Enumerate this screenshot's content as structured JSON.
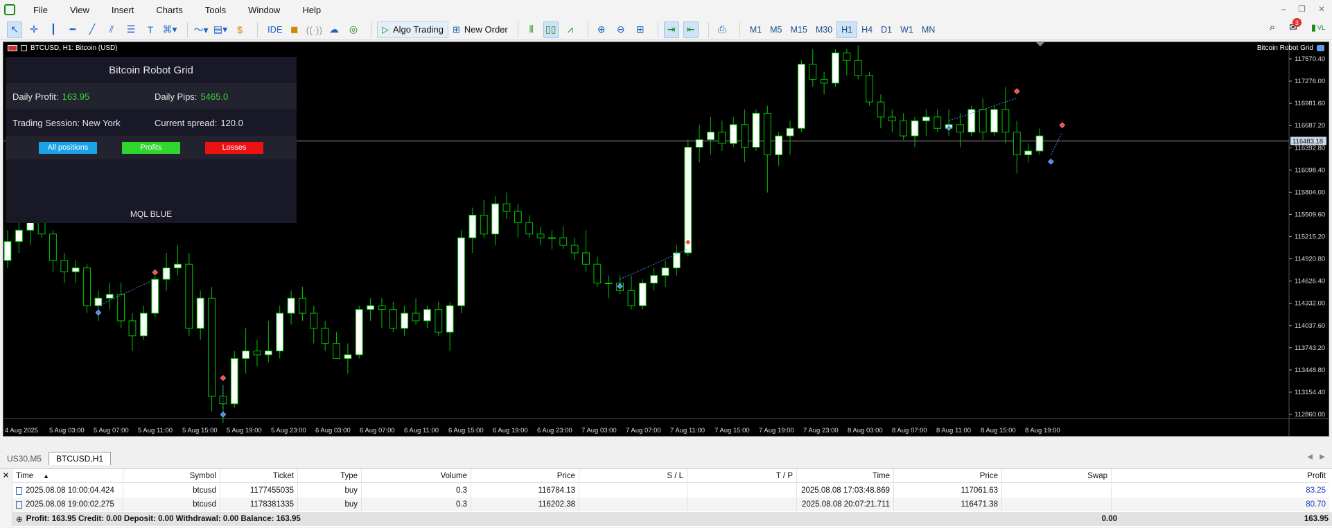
{
  "menu": [
    "File",
    "View",
    "Insert",
    "Charts",
    "Tools",
    "Window",
    "Help"
  ],
  "window_controls": [
    "⎯",
    "❐",
    "✕"
  ],
  "toolbar": {
    "ide_label": "IDE",
    "algo_trading_label": "Algo Trading",
    "new_order_label": "New Order",
    "timeframes": [
      "M1",
      "M5",
      "M15",
      "M30",
      "H1",
      "H4",
      "D1",
      "W1",
      "MN"
    ],
    "active_timeframe": "H1",
    "notification_count": "3",
    "vl_label": "VL"
  },
  "chart": {
    "title": "BTCUSD, H1:  Bitcoin (USD)",
    "ea_name": "Bitcoin Robot Grid",
    "current_price_label": "116483.18",
    "colors": {
      "background": "#000000",
      "bull_body": "#ffffff",
      "wick": "#00c800",
      "grid_line": "#9a9a9a",
      "buy_marker": "#4a8cff",
      "sell_marker": "#ff4a4a"
    }
  },
  "panel": {
    "title": "Bitcoin Robot Grid",
    "daily_profit_label": "Daily Profit:",
    "daily_profit_value": "163.95",
    "daily_pips_label": "Daily Pips:",
    "daily_pips_value": "5465.0",
    "session_label": "Trading Session: New York",
    "spread_label": "Current spread:",
    "spread_value": "120.0",
    "buttons": [
      {
        "label": "All positions",
        "color": "#1aa3e8"
      },
      {
        "label": "Profits",
        "color": "#2ed62e"
      },
      {
        "label": "Losses",
        "color": "#ee1111"
      }
    ],
    "brand": "MQL BLUE"
  },
  "chart_data": {
    "type": "candlestick",
    "symbol": "BTCUSD",
    "timeframe": "H1",
    "ylim": [
      112500,
      117800
    ],
    "y_ticks": [
      "117570.40",
      "117276.00",
      "116981.60",
      "116687.20",
      "116392.80",
      "116098.40",
      "115804.00",
      "115509.60",
      "115215.20",
      "114920.80",
      "114626.40",
      "114332.00",
      "114037.60",
      "113743.20",
      "113448.80",
      "113154.40",
      "112860.00"
    ],
    "x_labels": [
      "4 Aug 2025",
      "5 Aug 03:00",
      "5 Aug 07:00",
      "5 Aug 11:00",
      "5 Aug 15:00",
      "5 Aug 19:00",
      "5 Aug 23:00",
      "6 Aug 03:00",
      "6 Aug 07:00",
      "6 Aug 11:00",
      "6 Aug 15:00",
      "6 Aug 19:00",
      "6 Aug 23:00",
      "7 Aug 03:00",
      "7 Aug 07:00",
      "7 Aug 11:00",
      "7 Aug 15:00",
      "7 Aug 19:00",
      "7 Aug 23:00",
      "8 Aug 03:00",
      "8 Aug 07:00",
      "8 Aug 11:00",
      "8 Aug 15:00",
      "8 Aug 19:00"
    ],
    "current_price": 116483.18,
    "ohlc": [
      [
        114900,
        115300,
        114800,
        115150
      ],
      [
        115150,
        115450,
        115000,
        115300
      ],
      [
        115300,
        115600,
        115100,
        115550
      ],
      [
        115550,
        115700,
        115200,
        115250
      ],
      [
        115250,
        115300,
        114750,
        114900
      ],
      [
        114900,
        115000,
        114600,
        114750
      ],
      [
        114750,
        114900,
        114600,
        114800
      ],
      [
        114800,
        114850,
        114200,
        114300
      ],
      [
        114300,
        114500,
        114100,
        114400
      ],
      [
        114400,
        114600,
        114250,
        114450
      ],
      [
        114450,
        114600,
        114000,
        114100
      ],
      [
        114100,
        114200,
        113700,
        113900
      ],
      [
        113900,
        114300,
        113850,
        114200
      ],
      [
        114200,
        114700,
        114150,
        114650
      ],
      [
        114650,
        115000,
        114500,
        114800
      ],
      [
        114800,
        115100,
        114700,
        114850
      ],
      [
        114850,
        115000,
        113900,
        114000
      ],
      [
        114000,
        114500,
        113850,
        114400
      ],
      [
        114400,
        114550,
        112900,
        113100
      ],
      [
        113100,
        113250,
        112750,
        113000
      ],
      [
        113000,
        113700,
        112950,
        113600
      ],
      [
        113600,
        114000,
        113400,
        113700
      ],
      [
        113700,
        113850,
        113500,
        113650
      ],
      [
        113650,
        114100,
        113550,
        113700
      ],
      [
        113700,
        114300,
        113600,
        114200
      ],
      [
        114200,
        114500,
        114050,
        114400
      ],
      [
        114400,
        114550,
        114100,
        114200
      ],
      [
        114200,
        114300,
        113800,
        114000
      ],
      [
        114000,
        114100,
        113700,
        113800
      ],
      [
        113800,
        113950,
        113600,
        113600
      ],
      [
        113600,
        113800,
        113400,
        113650
      ],
      [
        113650,
        114300,
        113600,
        114250
      ],
      [
        114250,
        114400,
        114100,
        114300
      ],
      [
        114300,
        114400,
        114000,
        114250
      ],
      [
        114250,
        114350,
        113950,
        114000
      ],
      [
        114000,
        114300,
        113900,
        114200
      ],
      [
        114200,
        114400,
        114050,
        114100
      ],
      [
        114100,
        114300,
        114000,
        114250
      ],
      [
        114250,
        114350,
        113900,
        113950
      ],
      [
        113950,
        114350,
        113700,
        114300
      ],
      [
        114300,
        115300,
        114200,
        115200
      ],
      [
        115200,
        115600,
        115000,
        115500
      ],
      [
        115500,
        115700,
        115200,
        115250
      ],
      [
        115250,
        115750,
        115100,
        115650
      ],
      [
        115650,
        115800,
        115450,
        115550
      ],
      [
        115550,
        115650,
        115200,
        115400
      ],
      [
        115400,
        115500,
        115200,
        115250
      ],
      [
        115250,
        115350,
        115100,
        115200
      ],
      [
        115200,
        115300,
        115050,
        115200
      ],
      [
        115200,
        115350,
        115050,
        115100
      ],
      [
        115100,
        115200,
        114900,
        115000
      ],
      [
        115000,
        115300,
        114750,
        114850
      ],
      [
        114850,
        114950,
        114550,
        114600
      ],
      [
        114600,
        114700,
        114400,
        114600
      ],
      [
        114600,
        114700,
        114450,
        114500
      ],
      [
        114500,
        114700,
        114250,
        114300
      ],
      [
        114300,
        114650,
        114250,
        114600
      ],
      [
        114600,
        114800,
        114500,
        114700
      ],
      [
        114700,
        114900,
        114550,
        114800
      ],
      [
        114800,
        115100,
        114700,
        115000
      ],
      [
        115000,
        116500,
        114950,
        116400
      ],
      [
        116400,
        116700,
        116200,
        116500
      ],
      [
        116500,
        116800,
        116300,
        116600
      ],
      [
        116600,
        116750,
        116350,
        116450
      ],
      [
        116450,
        116800,
        116400,
        116700
      ],
      [
        116700,
        116900,
        116200,
        116400
      ],
      [
        116400,
        116900,
        116350,
        116850
      ],
      [
        116850,
        116950,
        115800,
        116300
      ],
      [
        116300,
        116600,
        116150,
        116550
      ],
      [
        116550,
        116750,
        116300,
        116650
      ],
      [
        116650,
        117550,
        116600,
        117500
      ],
      [
        117500,
        117700,
        117200,
        117300
      ],
      [
        117300,
        117400,
        117100,
        117250
      ],
      [
        117250,
        117700,
        117200,
        117650
      ],
      [
        117650,
        117700,
        117350,
        117550
      ],
      [
        117550,
        117750,
        117300,
        117350
      ],
      [
        117350,
        117400,
        116950,
        117000
      ],
      [
        117000,
        117100,
        116650,
        116800
      ],
      [
        116800,
        116900,
        116600,
        116750
      ],
      [
        116750,
        116850,
        116500,
        116550
      ],
      [
        116550,
        116800,
        116400,
        116750
      ],
      [
        116750,
        116900,
        116550,
        116800
      ],
      [
        116800,
        116900,
        116600,
        116650
      ],
      [
        116650,
        116900,
        116550,
        116700
      ],
      [
        116700,
        116850,
        116400,
        116600
      ],
      [
        116600,
        116950,
        116550,
        116900
      ],
      [
        116900,
        117050,
        116500,
        116600
      ],
      [
        116600,
        116950,
        116550,
        116900
      ],
      [
        116900,
        117200,
        116450,
        116600
      ],
      [
        116600,
        116750,
        116050,
        116300
      ],
      [
        116300,
        116450,
        116200,
        116350
      ],
      [
        116350,
        116650,
        116300,
        116550
      ]
    ],
    "trades": [
      {
        "type": "buy",
        "open_index": 8,
        "open_price": 114300,
        "close_index": 13,
        "close_price": 114650
      },
      {
        "type": "buy",
        "open_index": 19,
        "open_price": 112950,
        "close_index": 19,
        "close_price": 113250
      },
      {
        "type": "buy",
        "open_index": 54,
        "open_price": 114650,
        "close_index": 60,
        "close_price": 115050
      },
      {
        "type": "buy",
        "open_index": 83,
        "open_price": 116750,
        "close_index": 89,
        "close_price": 117050
      },
      {
        "type": "buy",
        "open_index": 92,
        "open_price": 116300,
        "close_index": 93,
        "close_price": 116600
      }
    ]
  },
  "tabs": [
    "US30,M5",
    "BTCUSD,H1"
  ],
  "active_tab": "BTCUSD,H1",
  "trade_table": {
    "headers": [
      "Time",
      "Symbol",
      "Ticket",
      "Type",
      "Volume",
      "Price",
      "S / L",
      "T / P",
      "Time",
      "Price",
      "Swap",
      "Profit"
    ],
    "sort_indicator": "▲",
    "rows": [
      [
        "2025.08.08 10:00:04.424",
        "btcusd",
        "1177455035",
        "buy",
        "0.3",
        "116784.13",
        "",
        "",
        "2025.08.08 17:03:48.869",
        "117061.63",
        "",
        "83.25"
      ],
      [
        "2025.08.08 19:00:02.275",
        "btcusd",
        "1178381335",
        "buy",
        "0.3",
        "116202.38",
        "",
        "",
        "2025.08.08 20:07:21.711",
        "116471.38",
        "",
        "80.70"
      ]
    ],
    "summary": {
      "text": "Profit: 163.95  Credit: 0.00  Deposit: 0.00  Withdrawal: 0.00  Balance: 163.95",
      "swap": "0.00",
      "profit": "163.95"
    }
  }
}
